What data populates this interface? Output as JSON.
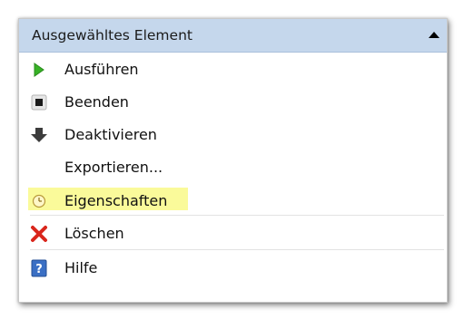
{
  "header": {
    "title": "Ausgewähltes Element",
    "toggle_icon": "triangle-up-icon"
  },
  "menu": {
    "items": [
      {
        "label": "Ausführen",
        "icon": "play-icon"
      },
      {
        "label": "Beenden",
        "icon": "stop-icon"
      },
      {
        "label": "Deaktivieren",
        "icon": "down-arrow-icon"
      },
      {
        "label": "Exportieren...",
        "icon": ""
      },
      {
        "label": "Eigenschaften",
        "icon": "properties-clock-icon",
        "highlighted": true
      },
      {
        "label": "Löschen",
        "icon": "delete-x-icon"
      },
      {
        "label": "Hilfe",
        "icon": "help-icon"
      }
    ]
  },
  "colors": {
    "header_bg": "#c5d7ec",
    "highlight": "#fafa9a",
    "play": "#37b226",
    "delete": "#d9261c",
    "help": "#3a6fc4"
  }
}
